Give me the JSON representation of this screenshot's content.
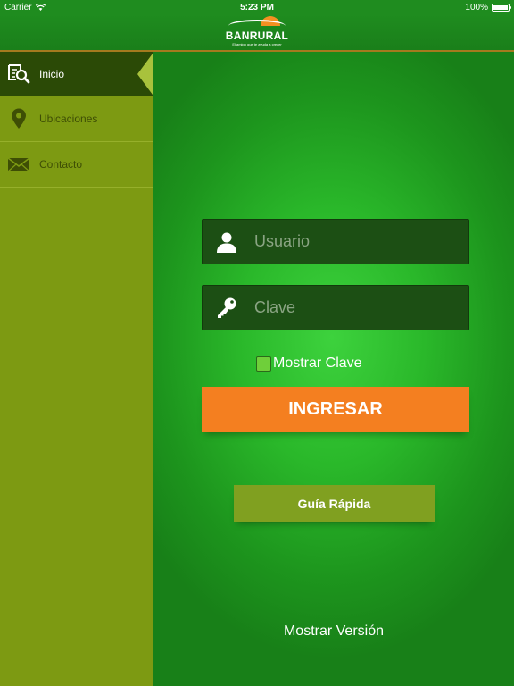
{
  "status_bar": {
    "carrier": "Carrier",
    "time": "5:23 PM",
    "battery": "100%"
  },
  "header": {
    "logo_text": "BANRURAL",
    "logo_tagline": "El amigo que te ayuda a crecer"
  },
  "sidebar": {
    "items": [
      {
        "label": "Inicio",
        "icon": "search-document-icon",
        "active": true
      },
      {
        "label": "Ubicaciones",
        "icon": "location-pin-icon",
        "active": false
      },
      {
        "label": "Contacto",
        "icon": "envelope-icon",
        "active": false
      }
    ]
  },
  "login": {
    "username_placeholder": "Usuario",
    "username_value": "",
    "password_placeholder": "Clave",
    "password_value": "",
    "show_password_label": "Mostrar Clave",
    "show_password_checked": false,
    "submit_label": "INGRESAR",
    "guide_label": "Guía Rápida",
    "version_label": "Mostrar Versión"
  },
  "colors": {
    "brand_green": "#1f8c1f",
    "sidebar_olive": "#7d9a12",
    "active_item": "#2b4a06",
    "accent_orange": "#f47f20",
    "field_bg": "#1c4f14"
  }
}
